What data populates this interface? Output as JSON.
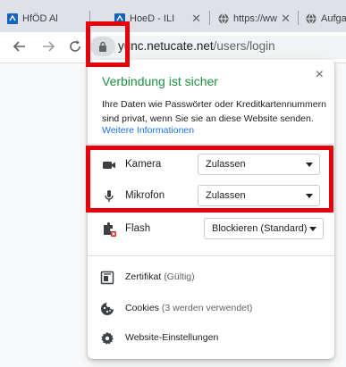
{
  "tabs": [
    {
      "title": "HfÖD Al",
      "favicon": "blue-square-icon"
    },
    {
      "title": "HoeD - ILI",
      "favicon": "blue-square-icon"
    },
    {
      "title": "https://ww",
      "favicon": "chrome-world-icon"
    },
    {
      "title": "Aufgab",
      "favicon": "chrome-world-icon"
    }
  ],
  "omnibox": {
    "url_host": "yu",
    "url_rest": "nc.netucate.net",
    "url_path": "/users/login"
  },
  "popup": {
    "title": "Verbindung ist sicher",
    "description": "Ihre Daten wie Passwörter oder Kreditkartennummern sind privat, wenn Sie sie an diese Website senden.",
    "link": "Weitere Informationen",
    "close": "×",
    "permissions": [
      {
        "label": "Kamera",
        "value": "Zulassen",
        "icon": "camera-icon"
      },
      {
        "label": "Mikrofon",
        "value": "Zulassen",
        "icon": "microphone-icon"
      },
      {
        "label": "Flash",
        "value": "Blockieren (Standard)",
        "icon": "flash-puzzle-icon"
      }
    ],
    "menu": [
      {
        "label": "Zertifikat",
        "sub": "(Gültig)",
        "icon": "certificate-icon"
      },
      {
        "label": "Cookies",
        "sub": "(3 werden verwendet)",
        "icon": "cookie-icon"
      },
      {
        "label": "Website-Einstellungen",
        "sub": "",
        "icon": "gear-icon"
      }
    ]
  },
  "colors": {
    "secure_green": "#1e8e3e",
    "link_blue": "#1a73e8",
    "annotation_red": "#e8000b"
  }
}
